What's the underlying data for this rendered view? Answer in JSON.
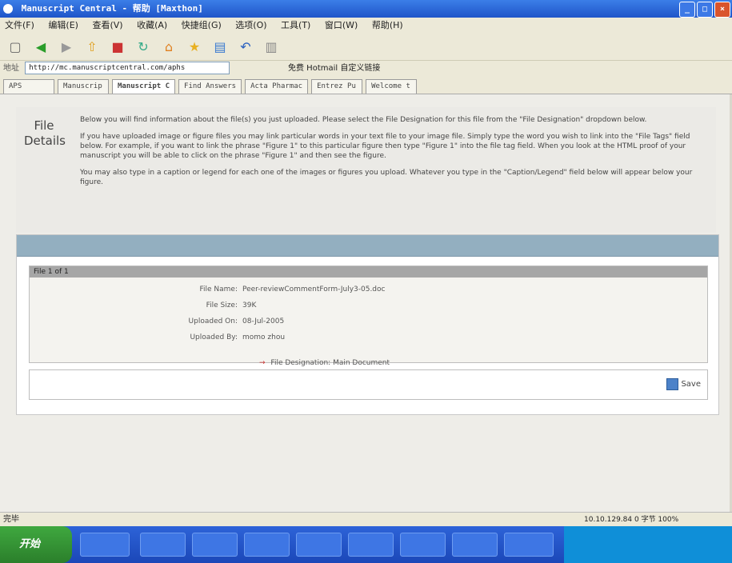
{
  "window": {
    "title": "Manuscript Central - 帮助 [Maxthon]"
  },
  "menu": [
    "文件(F)",
    "编辑(E)",
    "查看(V)",
    "收藏(A)",
    "快捷组(G)",
    "选项(O)",
    "工具(T)",
    "窗口(W)",
    "帮助(H)"
  ],
  "address": {
    "label": "地址",
    "url": "http://mc.manuscriptcentral.com/aphs",
    "extra": "免费 Hotmail  自定义链接"
  },
  "tabs": [
    "APS",
    "Manuscrip",
    "Manuscript C",
    "Find Answers",
    "Acta Pharmac",
    "Entrez Pu",
    "Welcome t"
  ],
  "page": {
    "title": "File Details",
    "paragraphs": [
      "Below you will find information about the file(s) you just uploaded. Please select the File Designation for this file from the \"File Designation\" dropdown below.",
      "If you have uploaded image or figure files you may link particular words in your text file to your image file. Simply type the word you wish to link into the \"File Tags\" field below. For example, if you want to link the phrase \"Figure 1\" to this particular figure then type \"Figure 1\" into the file tag field. When you look at the HTML proof of your manuscript you will be able to click on the phrase \"Figure 1\" and then see the figure.",
      "You may also type in a caption or legend for each one of the images or figures you upload. Whatever you type in the \"Caption/Legend\" field below will appear below your figure."
    ]
  },
  "file": {
    "header": "File 1 of 1",
    "rows": [
      {
        "key": "File Name:",
        "value": "Peer-reviewCommentForm-July3-05.doc"
      },
      {
        "key": "File Size:",
        "value": "39K"
      },
      {
        "key": "Uploaded On:",
        "value": "08-Jul-2005"
      },
      {
        "key": "Uploaded By:",
        "value": "momo zhou"
      }
    ],
    "designation": "File Designation: Main Document",
    "required_marker": "→"
  },
  "save_label": "Save",
  "status": {
    "left": "完毕",
    "right": "10.10.129.84   0 字节   100%"
  },
  "taskbar": {
    "start": "开始"
  }
}
